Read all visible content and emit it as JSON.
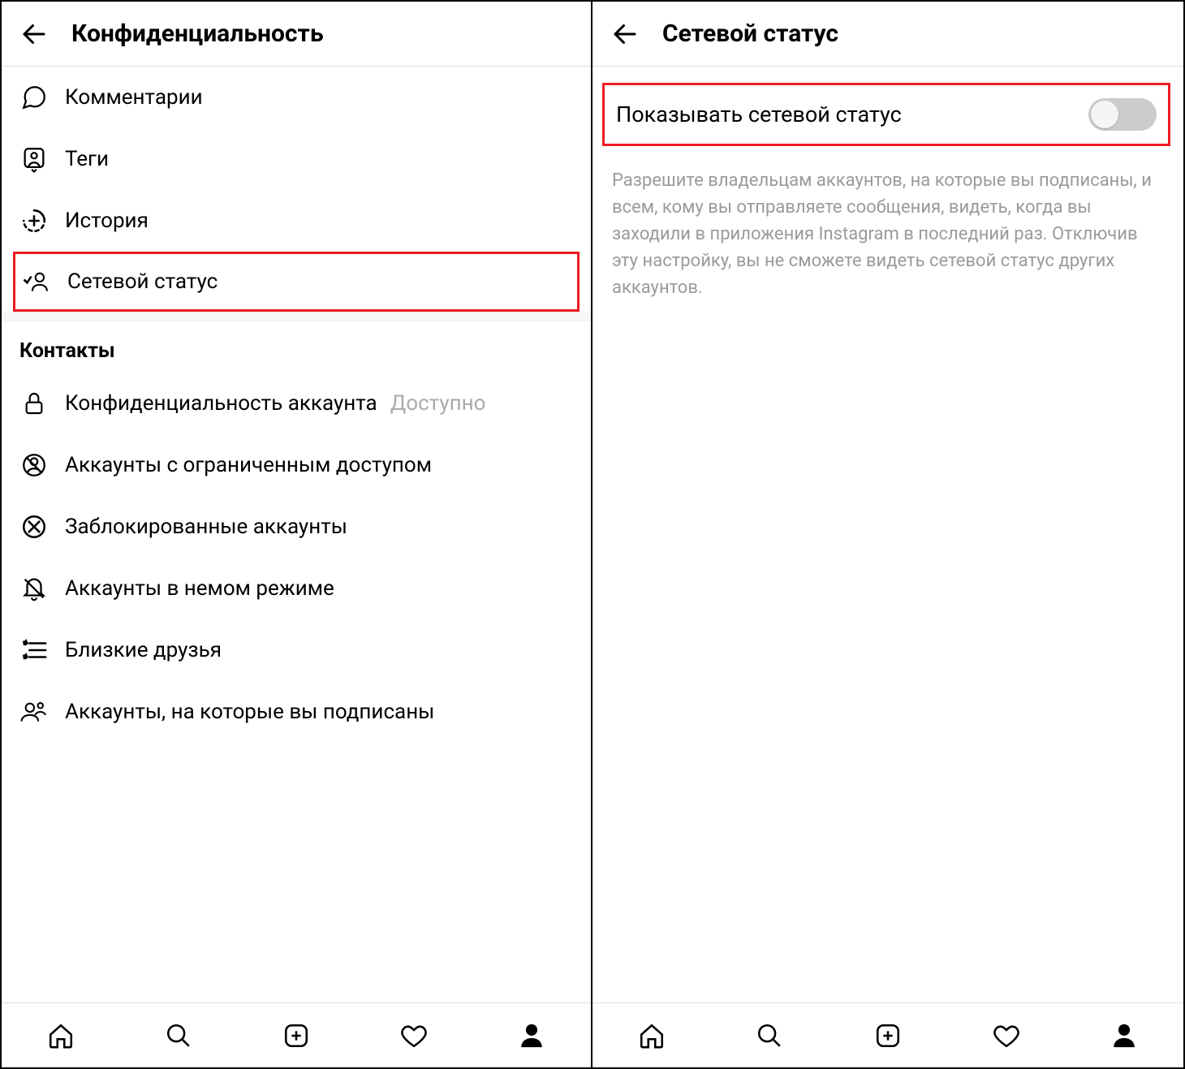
{
  "left": {
    "title": "Конфиденциальность",
    "items": [
      {
        "label": "Комментарии"
      },
      {
        "label": "Теги"
      },
      {
        "label": "История"
      },
      {
        "label": "Сетевой статус"
      }
    ],
    "section_title": "Контакты",
    "contacts_items": [
      {
        "label": "Конфиденциальность аккаунта",
        "value": "Доступно"
      },
      {
        "label": "Аккаунты с ограниченным доступом"
      },
      {
        "label": "Заблокированные аккаунты"
      },
      {
        "label": "Аккаунты в немом режиме"
      },
      {
        "label": "Близкие друзья"
      },
      {
        "label": "Аккаунты, на которые вы подписаны"
      }
    ]
  },
  "right": {
    "title": "Сетевой статус",
    "toggle_label": "Показывать сетевой статус",
    "toggle_on": false,
    "description": "Разрешите владельцам аккаунтов, на которые вы подписаны, и всем, кому вы отправляете сообщения, видеть, когда вы заходили в приложения Instagram в последний раз. Отключив эту настройку, вы не сможете видеть сетевой статус других аккаунтов."
  }
}
